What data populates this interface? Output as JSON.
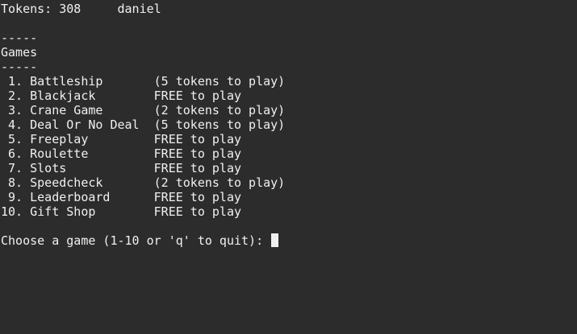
{
  "status": {
    "tokens_label": "Tokens:",
    "tokens_value": "308",
    "username": "daniel"
  },
  "section": {
    "rule_top": "-----",
    "title": "Games",
    "rule_bottom": "-----"
  },
  "games": [
    {
      "num": " 1.",
      "name": "Battleship",
      "cost": "(5 tokens to play)"
    },
    {
      "num": " 2.",
      "name": "Blackjack",
      "cost": "FREE to play"
    },
    {
      "num": " 3.",
      "name": "Crane Game",
      "cost": "(2 tokens to play)"
    },
    {
      "num": " 4.",
      "name": "Deal Or No Deal",
      "cost": "(5 tokens to play)"
    },
    {
      "num": " 5.",
      "name": "Freeplay",
      "cost": "FREE to play"
    },
    {
      "num": " 6.",
      "name": "Roulette",
      "cost": "FREE to play"
    },
    {
      "num": " 7.",
      "name": "Slots",
      "cost": "FREE to play"
    },
    {
      "num": " 8.",
      "name": "Speedcheck",
      "cost": "(2 tokens to play)"
    },
    {
      "num": " 9.",
      "name": "Leaderboard",
      "cost": "FREE to play"
    },
    {
      "num": "10.",
      "name": "Gift Shop",
      "cost": "FREE to play"
    }
  ],
  "prompt": {
    "text": "Choose a game (1-10 or 'q' to quit): "
  },
  "colors": {
    "background": "#2c2c2c",
    "foreground": "#f0f0f0"
  }
}
